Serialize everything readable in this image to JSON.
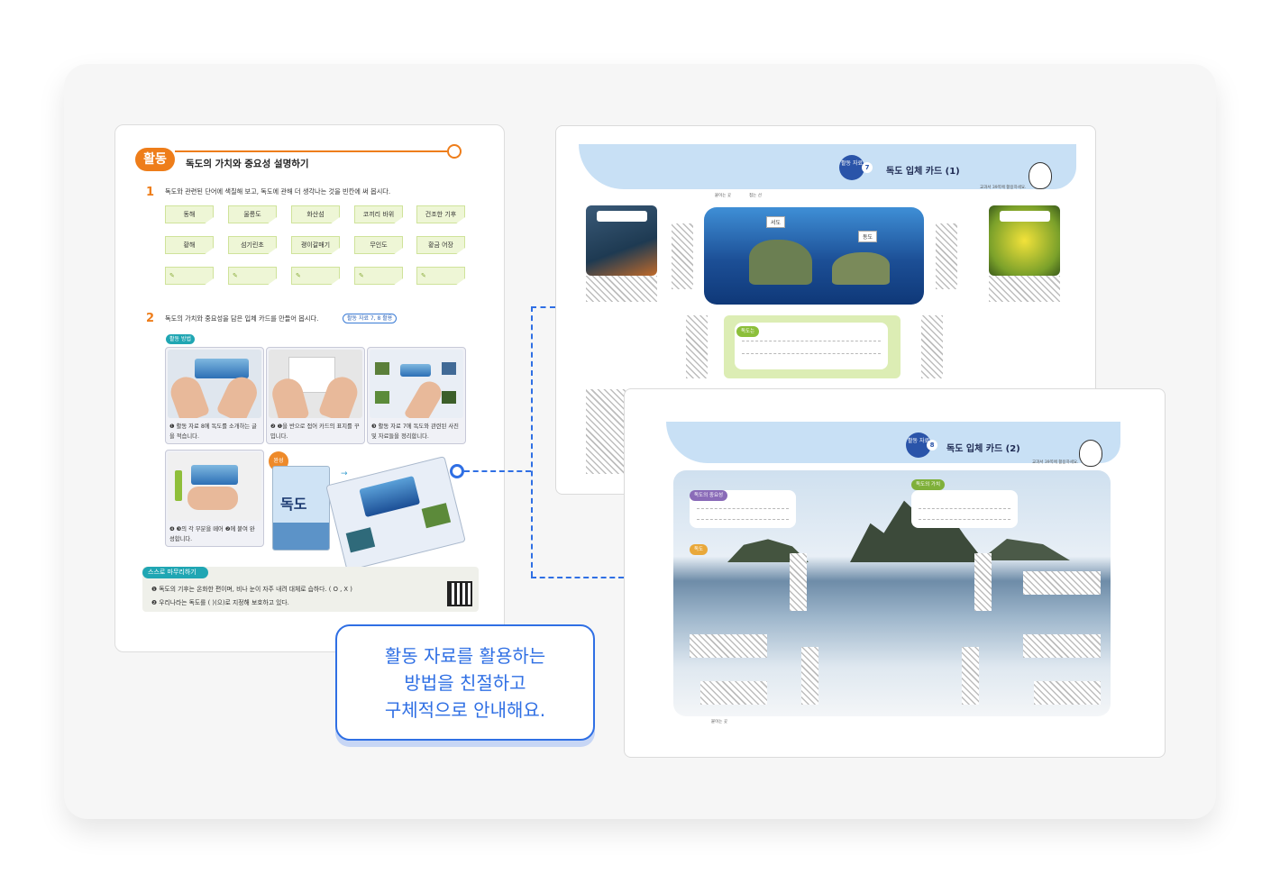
{
  "left_page": {
    "badge": "활동",
    "title": "독도의 가치와 중요성 설명하기",
    "q1_num": "1",
    "q1_text": "독도와 관련된 단어에 색칠해 보고, 독도에 관해 더 생각나는 것을 빈칸에 써 봅시다.",
    "words_row1": [
      "동해",
      "울릉도",
      "화산섬",
      "코끼리 바위",
      "건조한 기후"
    ],
    "words_row2": [
      "황해",
      "섬기린초",
      "괭이갈매기",
      "무인도",
      "황금 어장"
    ],
    "pencil": "✎",
    "q2_num": "2",
    "q2_text": "독도의 가치와 중요성을 담은 입체 카드를 만들어 봅시다.",
    "q2_pill": "활동 자료 7, 8 활용",
    "method_tag": "활동 방법",
    "steps": [
      {
        "caption": "❶ 활동 자료 8에 독도를 소개하는 글을 적습니다."
      },
      {
        "caption": "❷ ❶을 반으로 접어 카드의 표지를 꾸밉니다."
      },
      {
        "caption": "❸ 활동 자료 7에 독도와 관련된 사진 및 자료들을 정리합니다."
      },
      {
        "caption": "❹ ❸의 각 부분을 떼어 ❷에 붙여 완성합니다."
      }
    ],
    "done_label": "완성",
    "cover_word": "독도",
    "summary_tag": "스스로 마무리하기",
    "summary_line1": "❶ 독도의 기후는 온화한 편이며, 비나 눈이 자주 내려 대체로 습하다. ( O , X )",
    "summary_line2": "❷ 우리나라는 독도를 (                              )(으)로 지정해 보호하고 있다."
  },
  "page7": {
    "badge": "활동 자료",
    "number": "7",
    "title": "독도 입체 카드 (1)",
    "legend_fold": "붙이는 곳",
    "legend_cut": "접는 선",
    "note": "교과서 39쪽에 활용하세요.",
    "flag_left": "서도",
    "flag_right": "동도",
    "write_label": "독도는"
  },
  "page8": {
    "badge": "활동 자료",
    "number": "8",
    "title": "독도 입체 카드 (2)",
    "note": "교과서 39쪽에 활용하세요.",
    "label_left": "독도의 중요성",
    "label_right": "독도의 가치",
    "label_lighthouse": "독도",
    "legend": "붙이는 곳"
  },
  "callout": {
    "line1": "활동 자료를 활용하는",
    "line2": "방법을 친절하고",
    "line3": "구체적으로 안내해요."
  },
  "colors": {
    "accent_orange": "#ee7d1a",
    "accent_blue": "#2f6fe4",
    "teal": "#20a6b3",
    "sky": "#c8e0f5"
  }
}
